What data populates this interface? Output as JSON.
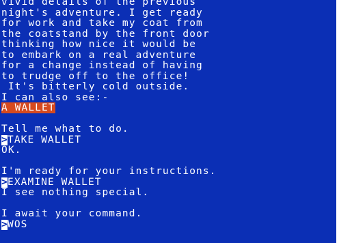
{
  "colors": {
    "background": "#0b2fb5",
    "text": "#ffffff",
    "highlight": "#d64a1f"
  },
  "narrative": [
    "vivid details of the previous",
    "night's adventure. I get ready",
    "for work and take my coat from",
    "the coatstand by the front door",
    "thinking how nice it would be",
    "to embark on a real adventure",
    "for a change instead of having",
    "to trudge off to the office!",
    " It's bitterly cold outside.",
    "I can also see:-"
  ],
  "visible_item": "A WALLET",
  "exchanges": [
    {
      "prompt": "Tell me what to do.",
      "command": "TAKE WALLET",
      "response": "OK."
    },
    {
      "prompt": "I'm ready for your instructions.",
      "command": "EXAMINE WALLET",
      "response": "I see nothing special."
    },
    {
      "prompt": "I await your command.",
      "command": "WOS",
      "response": ""
    }
  ],
  "cursor_glyph": ">"
}
